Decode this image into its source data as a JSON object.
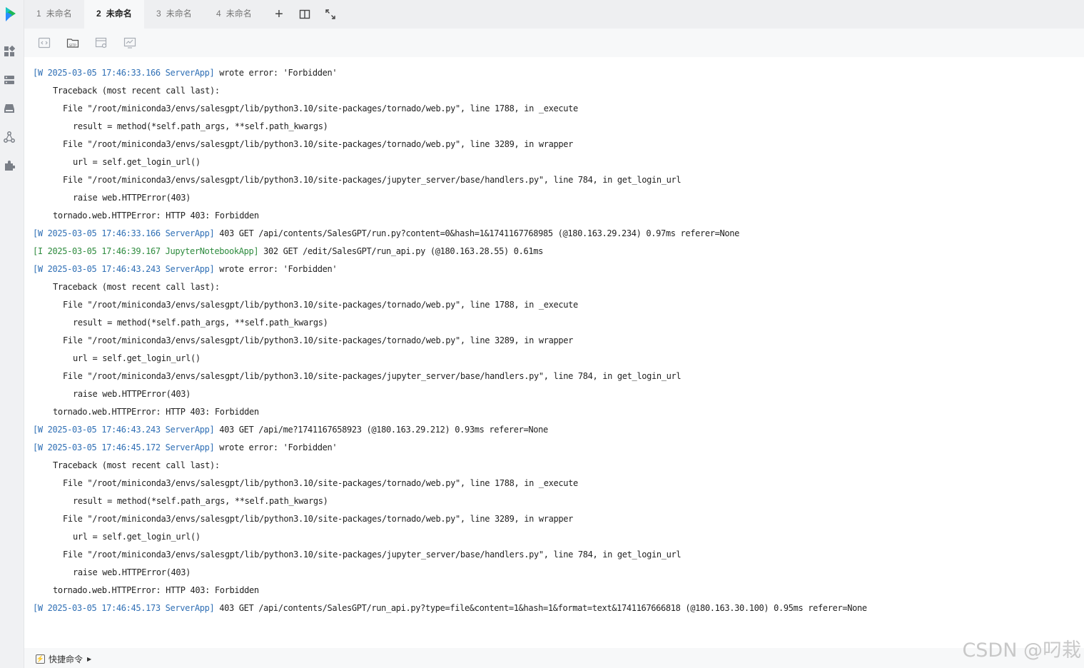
{
  "tabs": [
    {
      "num": "1",
      "label": "未命名",
      "active": false
    },
    {
      "num": "2",
      "label": "未命名",
      "active": true
    },
    {
      "num": "3",
      "label": "未命名",
      "active": false
    },
    {
      "num": "4",
      "label": "未命名",
      "active": false
    }
  ],
  "tab_actions": {
    "add": "+"
  },
  "terminal": {
    "lines": [
      {
        "prefix": "[W 2025-03-05 17:46:33.166 ServerApp]",
        "kind": "w",
        "text": " wrote error: 'Forbidden'",
        "indent": 0
      },
      {
        "prefix": "",
        "kind": "",
        "text": "Traceback (most recent call last):",
        "indent": 4
      },
      {
        "prefix": "",
        "kind": "",
        "text": "File \"/root/miniconda3/envs/salesgpt/lib/python3.10/site-packages/tornado/web.py\", line 1788, in _execute",
        "indent": 6
      },
      {
        "prefix": "",
        "kind": "",
        "text": "result = method(*self.path_args, **self.path_kwargs)",
        "indent": 8
      },
      {
        "prefix": "",
        "kind": "",
        "text": "File \"/root/miniconda3/envs/salesgpt/lib/python3.10/site-packages/tornado/web.py\", line 3289, in wrapper",
        "indent": 6
      },
      {
        "prefix": "",
        "kind": "",
        "text": "url = self.get_login_url()",
        "indent": 8
      },
      {
        "prefix": "",
        "kind": "",
        "text": "File \"/root/miniconda3/envs/salesgpt/lib/python3.10/site-packages/jupyter_server/base/handlers.py\", line 784, in get_login_url",
        "indent": 6
      },
      {
        "prefix": "",
        "kind": "",
        "text": "raise web.HTTPError(403)",
        "indent": 8
      },
      {
        "prefix": "",
        "kind": "",
        "text": "tornado.web.HTTPError: HTTP 403: Forbidden",
        "indent": 4
      },
      {
        "prefix": "[W 2025-03-05 17:46:33.166 ServerApp]",
        "kind": "w",
        "text": " 403 GET /api/contents/SalesGPT/run.py?content=0&hash=1&1741167768985 (@180.163.29.234) 0.97ms referer=None",
        "indent": 0
      },
      {
        "prefix": "[I 2025-03-05 17:46:39.167 JupyterNotebookApp]",
        "kind": "i",
        "text": " 302 GET /edit/SalesGPT/run_api.py (@180.163.28.55) 0.61ms",
        "indent": 0
      },
      {
        "prefix": "[W 2025-03-05 17:46:43.243 ServerApp]",
        "kind": "w",
        "text": " wrote error: 'Forbidden'",
        "indent": 0
      },
      {
        "prefix": "",
        "kind": "",
        "text": "Traceback (most recent call last):",
        "indent": 4
      },
      {
        "prefix": "",
        "kind": "",
        "text": "File \"/root/miniconda3/envs/salesgpt/lib/python3.10/site-packages/tornado/web.py\", line 1788, in _execute",
        "indent": 6
      },
      {
        "prefix": "",
        "kind": "",
        "text": "result = method(*self.path_args, **self.path_kwargs)",
        "indent": 8
      },
      {
        "prefix": "",
        "kind": "",
        "text": "File \"/root/miniconda3/envs/salesgpt/lib/python3.10/site-packages/tornado/web.py\", line 3289, in wrapper",
        "indent": 6
      },
      {
        "prefix": "",
        "kind": "",
        "text": "url = self.get_login_url()",
        "indent": 8
      },
      {
        "prefix": "",
        "kind": "",
        "text": "File \"/root/miniconda3/envs/salesgpt/lib/python3.10/site-packages/jupyter_server/base/handlers.py\", line 784, in get_login_url",
        "indent": 6
      },
      {
        "prefix": "",
        "kind": "",
        "text": "raise web.HTTPError(403)",
        "indent": 8
      },
      {
        "prefix": "",
        "kind": "",
        "text": "tornado.web.HTTPError: HTTP 403: Forbidden",
        "indent": 4
      },
      {
        "prefix": "[W 2025-03-05 17:46:43.243 ServerApp]",
        "kind": "w",
        "text": " 403 GET /api/me?1741167658923 (@180.163.29.212) 0.93ms referer=None",
        "indent": 0
      },
      {
        "prefix": "[W 2025-03-05 17:46:45.172 ServerApp]",
        "kind": "w",
        "text": " wrote error: 'Forbidden'",
        "indent": 0
      },
      {
        "prefix": "",
        "kind": "",
        "text": "Traceback (most recent call last):",
        "indent": 4
      },
      {
        "prefix": "",
        "kind": "",
        "text": "File \"/root/miniconda3/envs/salesgpt/lib/python3.10/site-packages/tornado/web.py\", line 1788, in _execute",
        "indent": 6
      },
      {
        "prefix": "",
        "kind": "",
        "text": "result = method(*self.path_args, **self.path_kwargs)",
        "indent": 8
      },
      {
        "prefix": "",
        "kind": "",
        "text": "File \"/root/miniconda3/envs/salesgpt/lib/python3.10/site-packages/tornado/web.py\", line 3289, in wrapper",
        "indent": 6
      },
      {
        "prefix": "",
        "kind": "",
        "text": "url = self.get_login_url()",
        "indent": 8
      },
      {
        "prefix": "",
        "kind": "",
        "text": "File \"/root/miniconda3/envs/salesgpt/lib/python3.10/site-packages/jupyter_server/base/handlers.py\", line 784, in get_login_url",
        "indent": 6
      },
      {
        "prefix": "",
        "kind": "",
        "text": "raise web.HTTPError(403)",
        "indent": 8
      },
      {
        "prefix": "",
        "kind": "",
        "text": "tornado.web.HTTPError: HTTP 403: Forbidden",
        "indent": 4
      },
      {
        "prefix": "[W 2025-03-05 17:46:45.173 ServerApp]",
        "kind": "w",
        "text": " 403 GET /api/contents/SalesGPT/run_api.py?type=file&content=1&hash=1&format=text&1741167666818 (@180.163.30.100) 0.95ms referer=None",
        "indent": 0
      }
    ]
  },
  "bottom_bar": {
    "quick_commands": "快捷命令"
  },
  "watermark": "CSDN @叼栽",
  "colors": {
    "warn_prefix": "#2f6fb5",
    "info_prefix": "#2e8b3e",
    "brand_logo": "#1db954"
  }
}
